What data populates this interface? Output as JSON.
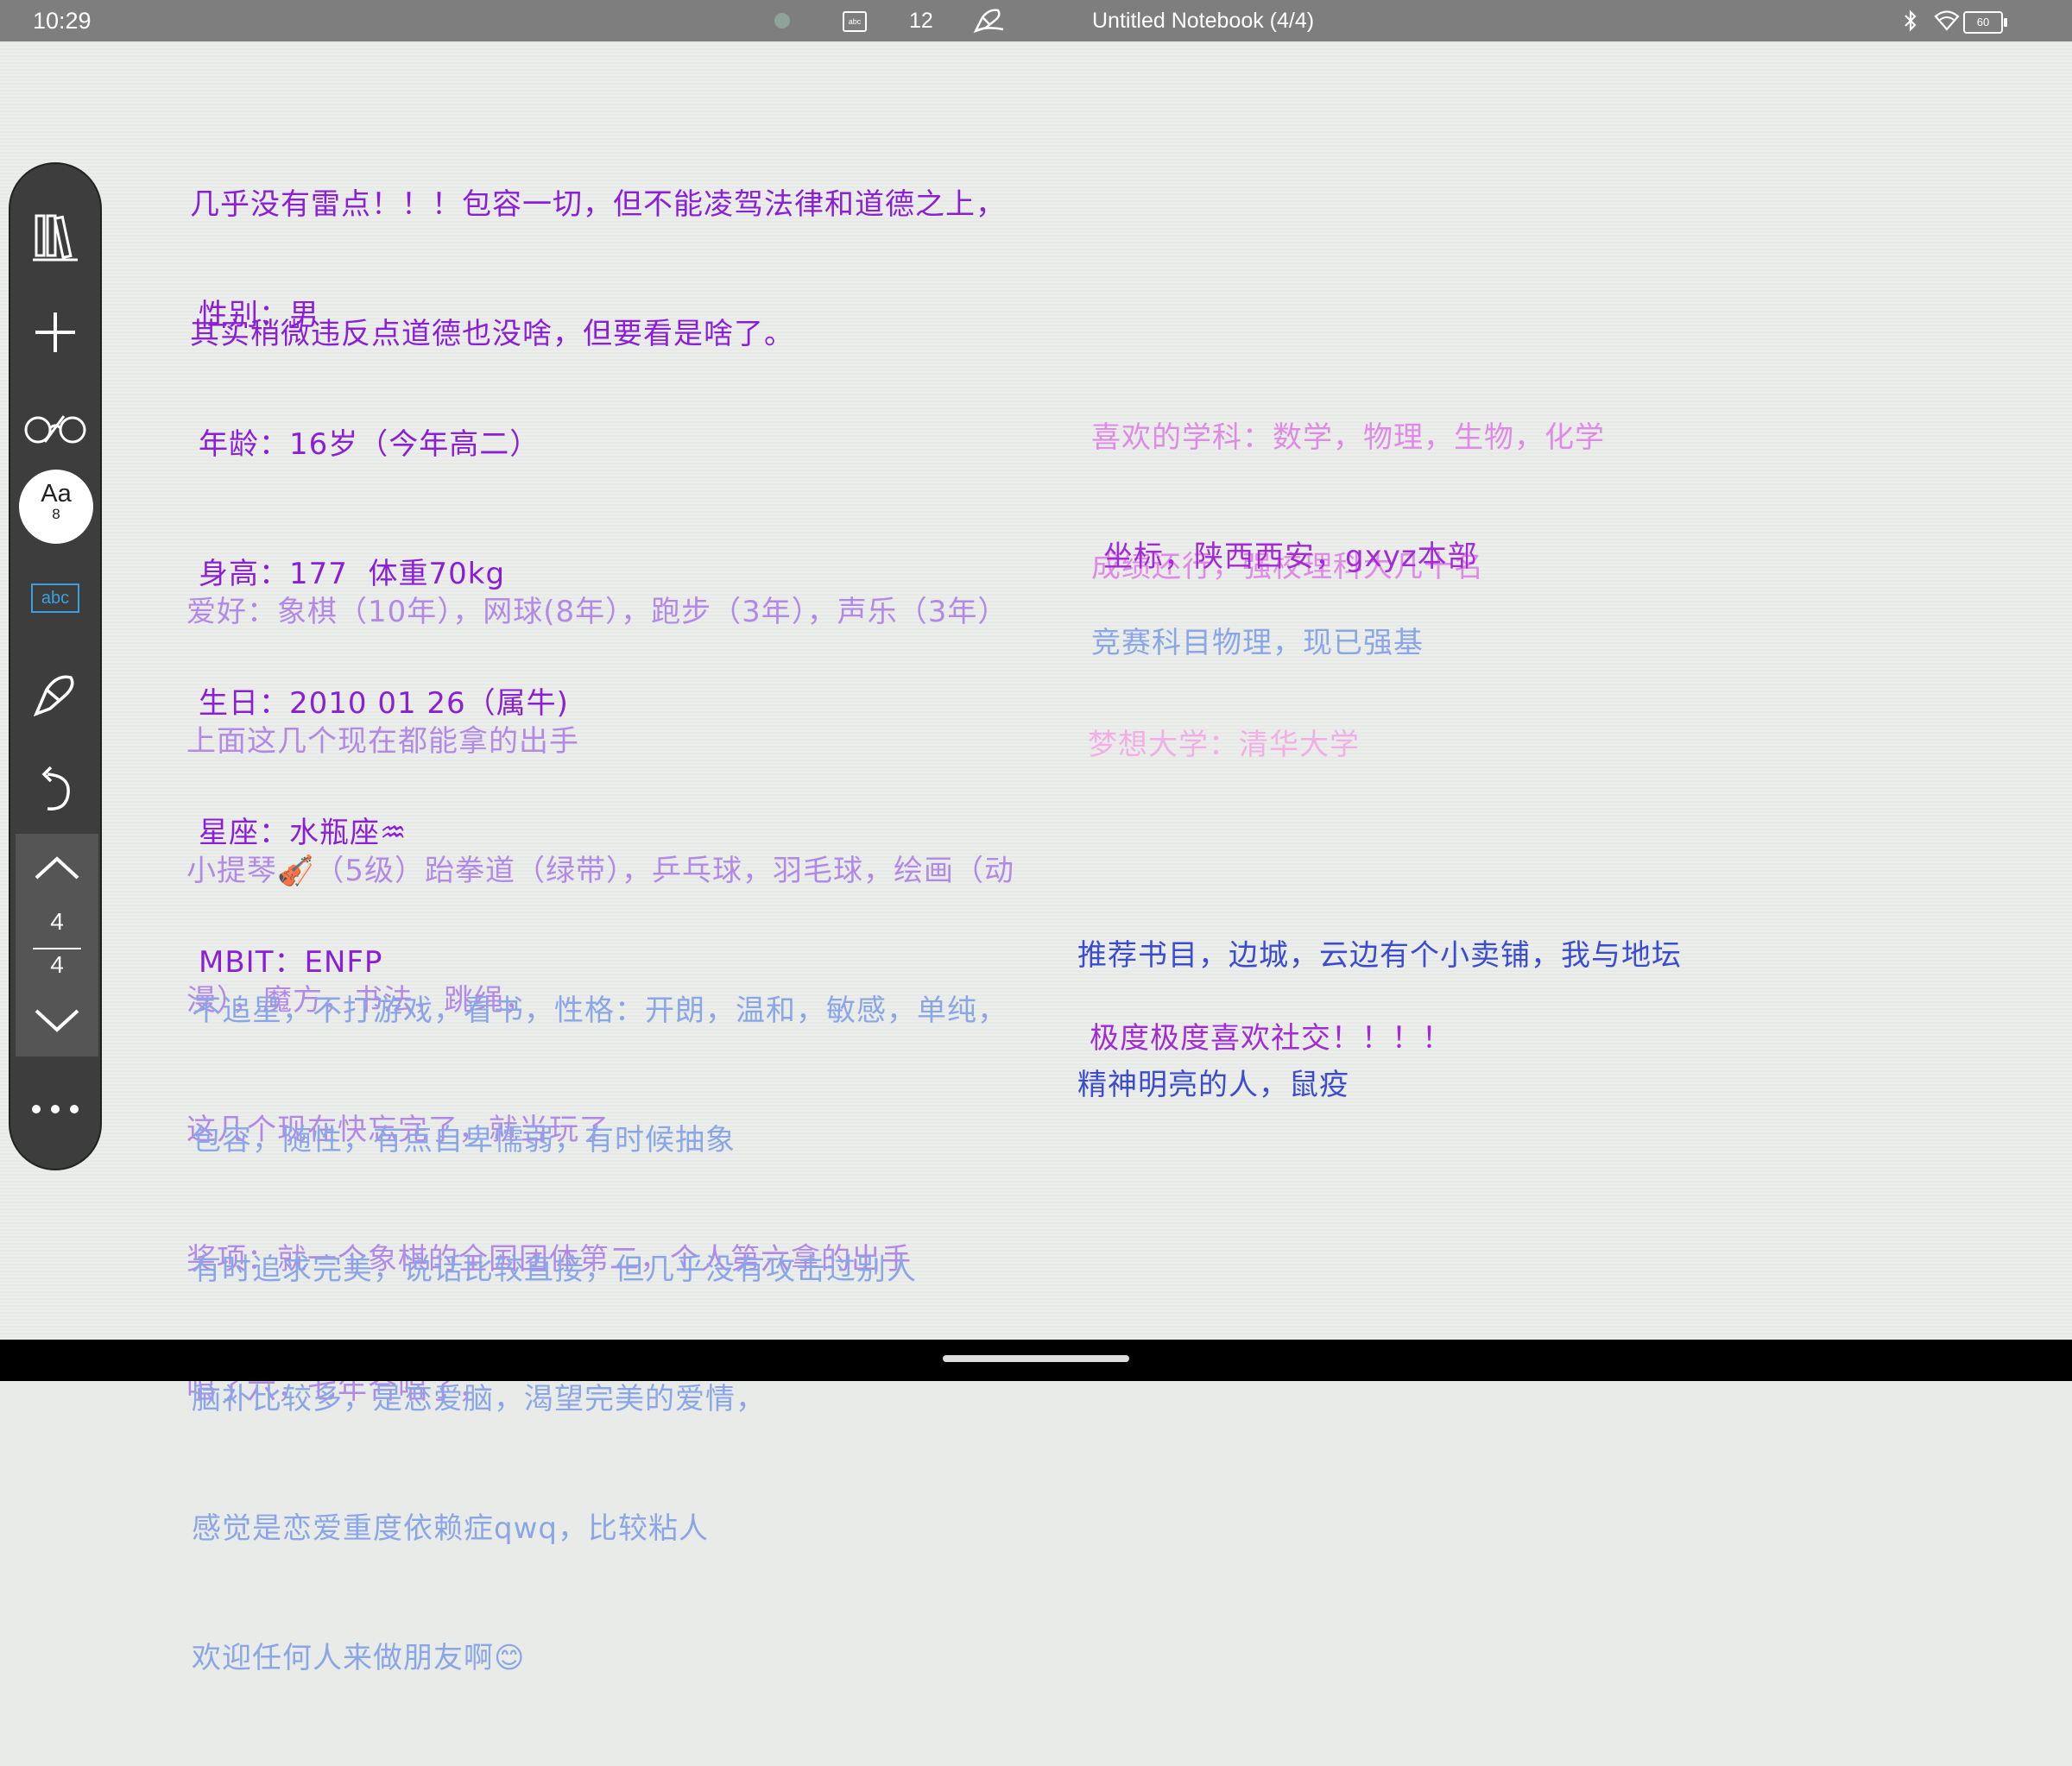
{
  "status_bar": {
    "time": "10:29",
    "keyboard_label": "abc",
    "pen_size": "12",
    "title": "Untitled Notebook (4/4)",
    "battery": "60",
    "icons": [
      "sync-dot-icon",
      "keyboard-icon",
      "pen-icon",
      "bluetooth-icon",
      "wifi-icon",
      "battery-icon"
    ]
  },
  "toolbar": {
    "icons": [
      "library-icon",
      "add-icon",
      "glasses-icon",
      "font-icon",
      "text-recognition-icon",
      "lasso-icon",
      "undo-icon",
      "page-up-icon",
      "page-down-icon",
      "more-icon"
    ],
    "font_label": "Aa",
    "font_size": "8",
    "abc_label": "abc",
    "page_current": "4",
    "page_total": "4"
  },
  "notes": {
    "intro": [
      "几乎没有雷点！！！包容一切，但不能凌驾法律和道德之上，",
      "其实稍微违反点道德也没啥，但要看是啥了。"
    ],
    "profile": [
      "性别：男",
      "年龄：16岁（今年高二）",
      "身高：177  体重70kg",
      "生日：2010 01 26（属牛)",
      "星座：水瓶座♒",
      "MBIT：ENFP"
    ],
    "hobbies": [
      "爱好：象棋（10年），网球(8年），跑步（3年），声乐（3年）",
      "上面这几个现在都能拿的出手",
      "小提琴🎻（5级）跆拳道（绿带），乒乓球，羽毛球，绘画（动",
      "漫），魔方，书法，跳绳，",
      "这几个现在快忘完了，就当玩了",
      "奖项：就一个象棋的全国团体第二，个人第六拿的出手",
      "唱了六，七年合唱了，"
    ],
    "personality": [
      "不追星，不打游戏，看书，性格：开朗，温和，敏感，单纯，",
      "包容，随性，有点自卑懦弱，有时候抽象",
      "有时追求完美，说话比较直接，但几乎没有攻击过别人",
      "脑补比较多，是恋爱脑，渴望完美的爱情，",
      "感觉是恋爱重度依赖症qwq，比较粘人",
      "欢迎任何人来做朋友啊😊"
    ],
    "subjects": [
      "喜欢的学科：数学，物理，生物，化学",
      "成绩还行，强校理科大几十名"
    ],
    "location": "坐标，陕西西安，gxyz本部",
    "competition": "竞赛科目物理，现已强基",
    "dream": "梦想大学：清华大学",
    "books": [
      "推荐书目，边城，云边有个小卖铺，我与地坛",
      "精神明亮的人，鼠疫"
    ],
    "social": "极度极度喜欢社交！！！！"
  },
  "colors": {
    "purple": "#8a1fd6",
    "lavender": "#b28ae6",
    "pink": "#de8ae6",
    "blue": "#8aa6e6",
    "light_pink": "#f2aee6",
    "royal_blue": "#3b4ccf",
    "magenta": "#a22bd6"
  }
}
